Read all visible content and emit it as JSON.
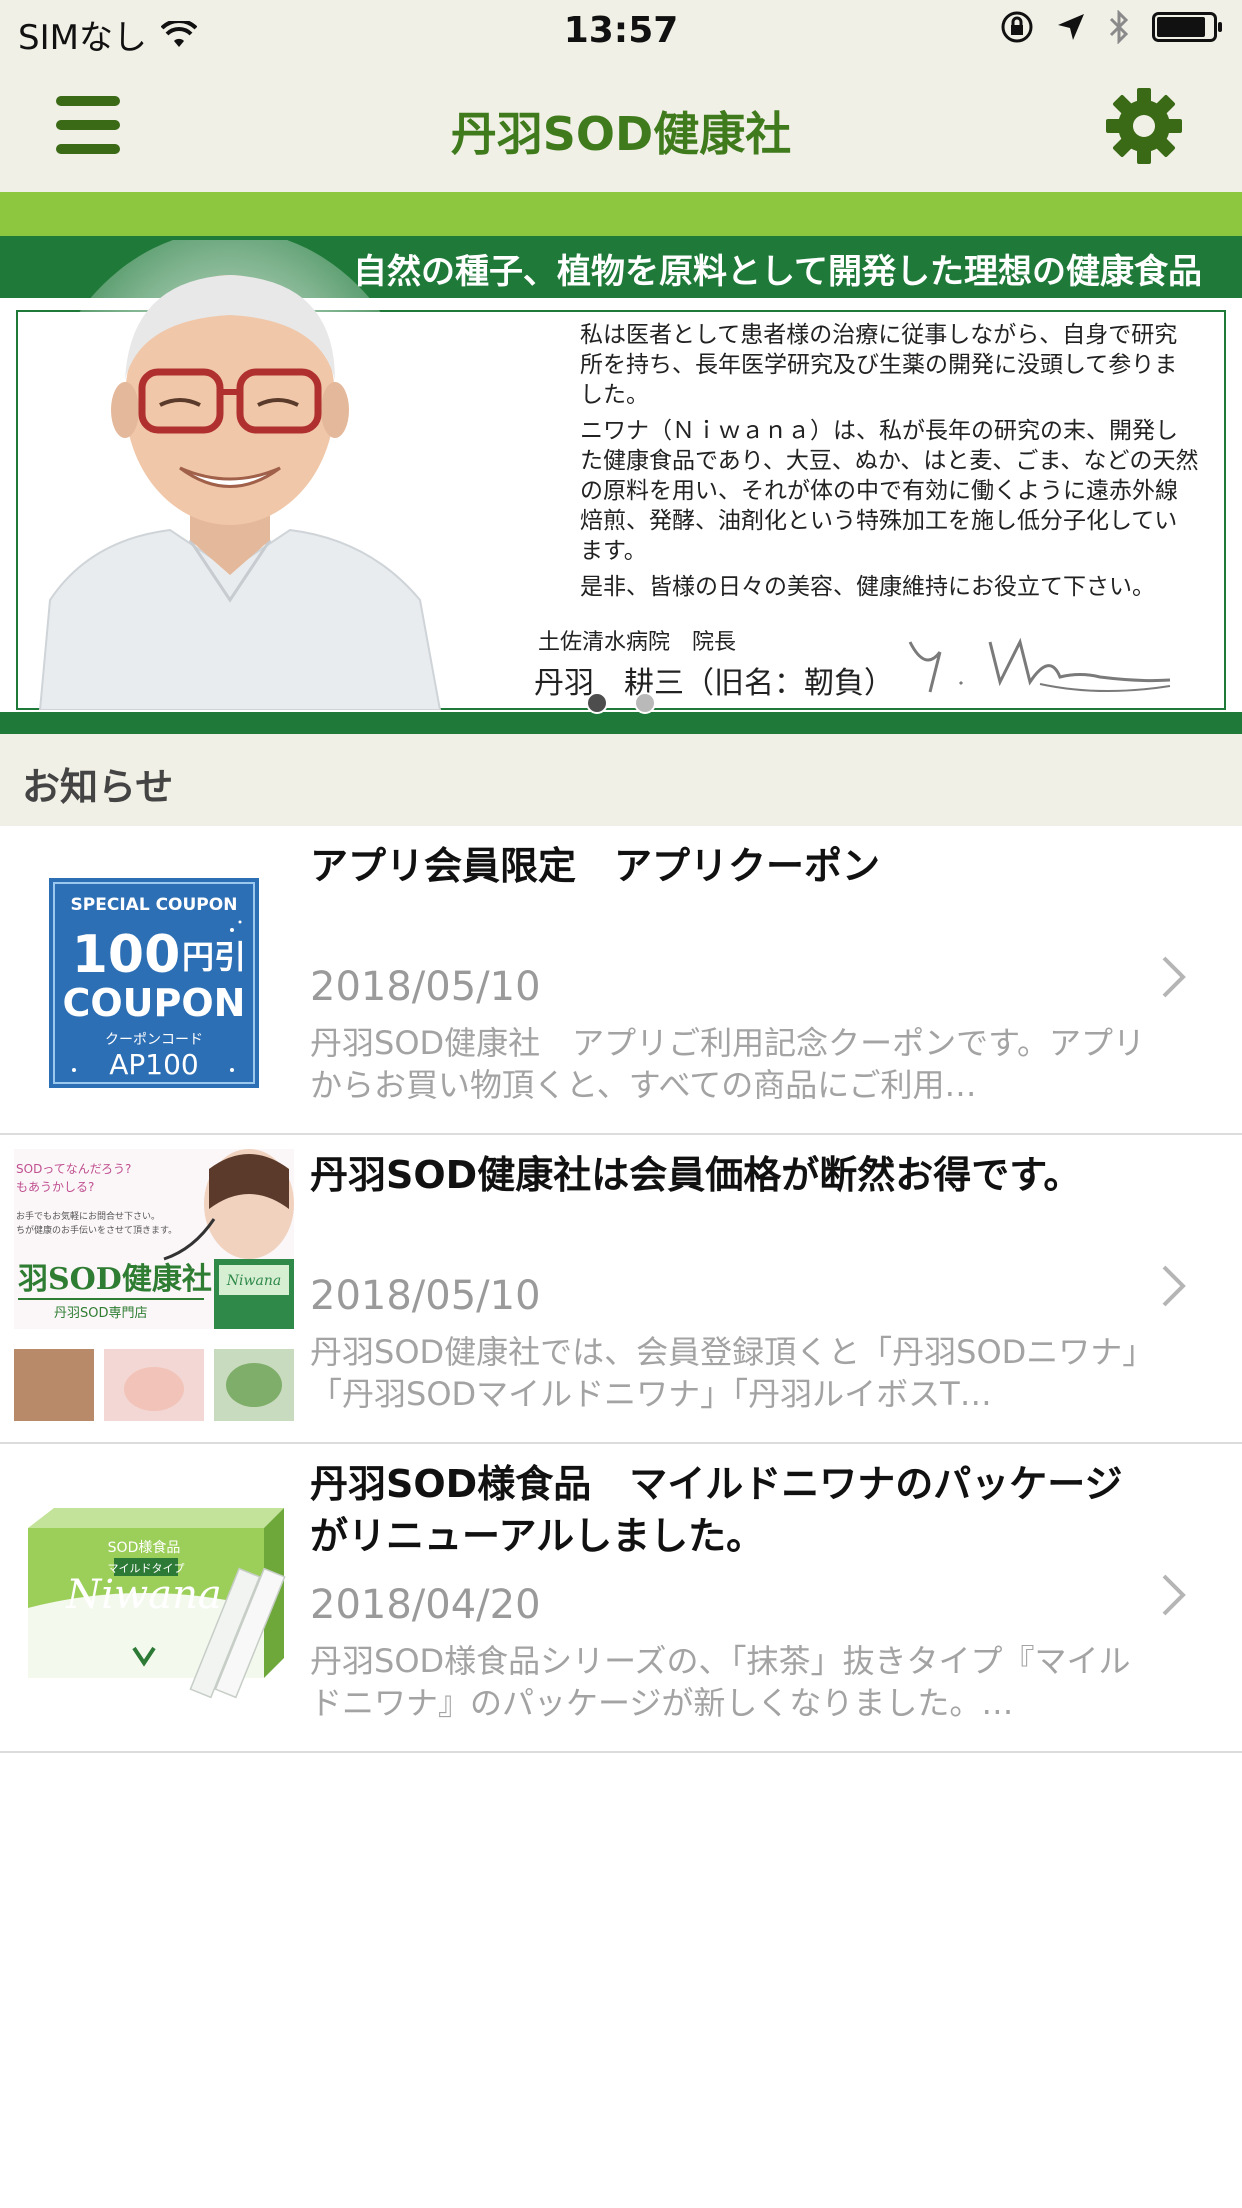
{
  "status_bar": {
    "carrier": "SIMなし",
    "time": "13:57"
  },
  "nav": {
    "title": "丹羽SOD健康社"
  },
  "banner": {
    "headline": "自然の種子、植物を原料として開発した理想の健康食品",
    "paragraphs": [
      "私は医者として患者様の治療に従事しながら、自身で研究所を持ち、長年医学研究及び生薬の開発に没頭して参りました。",
      "ニワナ（Ｎｉｗａｎａ）は、私が長年の研究の末、開発した健康食品であり、大豆、ぬか、はと麦、ごま、などの天然の原料を用い、それが体の中で有効に働くように遠赤外線焙煎、発酵、油剤化という特殊加工を施し低分子化しています。",
      "是非、皆様の日々の美容、健康維持にお役立て下さい。"
    ],
    "role": "土佐清水病院　院長",
    "name": "丹羽　耕三（旧名：靭負）",
    "signature": "Y. Niwa",
    "pages": 2,
    "current_page": 1
  },
  "section": {
    "label": "お知らせ"
  },
  "news": [
    {
      "title": "アプリ会員限定　アプリクーポン",
      "date": "2018/05/10",
      "desc": "丹羽SOD健康社　アプリご利用記念クーポンです。アプリからお買い物頂くと、すべての商品にご利用…",
      "thumb": {
        "kicker": "SPECIAL COUPON",
        "amount": "100",
        "unit": "円引",
        "word": "COUPON",
        "code_label": "クーポンコード",
        "code": "AP100"
      }
    },
    {
      "title": "丹羽SOD健康社は会員価格が断然お得です。",
      "date": "2018/05/10",
      "desc": "丹羽SOD健康社では、会員登録頂くと「丹羽SODニワナ」「丹羽SODマイルドニワナ」「丹羽ルイボスT…",
      "thumb": {
        "line1": "SODってなんだろう?",
        "line2": "もあうかしる?",
        "line3": "お手でもお気軽にお問合せ下さい。",
        "line4": "ちが健康のお手伝いをさせて頂きます。",
        "brand": "羽SOD健康社",
        "shop": "丹羽SOD専門店",
        "box_label": "Niwana"
      }
    },
    {
      "title": "丹羽SOD様食品　マイルドニワナのパッケージがリニューアルしました。",
      "date": "2018/04/20",
      "desc": "丹羽SOD様食品シリーズの、「抹茶」抜きタイプ『マイルドニワナ』のパッケージが新しくなりました。…",
      "thumb": {
        "label": "SOD様食品",
        "sub": "マイルドタイプ",
        "brand": "Niwana"
      }
    }
  ],
  "colors": {
    "nav_bg": "#f1f0e6",
    "brand_green": "#3f7a1c",
    "banner_dark_green": "#1f7a3a",
    "banner_light_green": "#8dc63f"
  }
}
